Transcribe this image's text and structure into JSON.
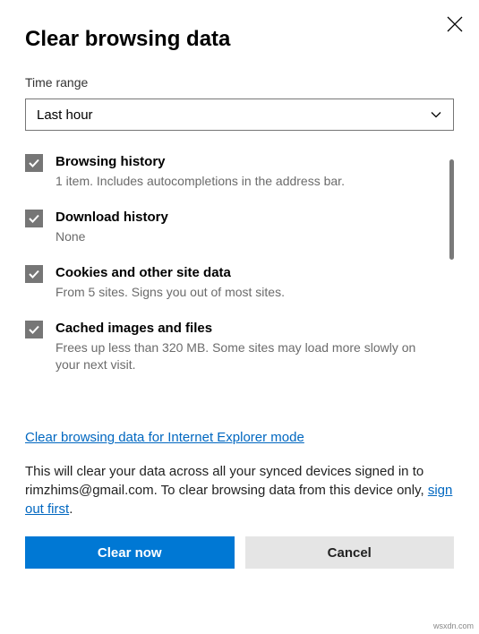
{
  "title": "Clear browsing data",
  "timeRangeLabel": "Time range",
  "timeRangeValue": "Last hour",
  "items": [
    {
      "title": "Browsing history",
      "desc": "1 item. Includes autocompletions in the address bar."
    },
    {
      "title": "Download history",
      "desc": "None"
    },
    {
      "title": "Cookies and other site data",
      "desc": "From 5 sites. Signs you out of most sites."
    },
    {
      "title": "Cached images and files",
      "desc": "Frees up less than 320 MB. Some sites may load more slowly on your next visit."
    }
  ],
  "ieLink": "Clear browsing data for Internet Explorer mode",
  "syncText1": "This will clear your data across all your synced devices signed in to rimzhims@gmail.com. To clear browsing data from this device only, ",
  "syncLink": "sign out first",
  "syncText2": ".",
  "clearBtn": "Clear now",
  "cancelBtn": "Cancel",
  "watermark": "wsxdn.com"
}
